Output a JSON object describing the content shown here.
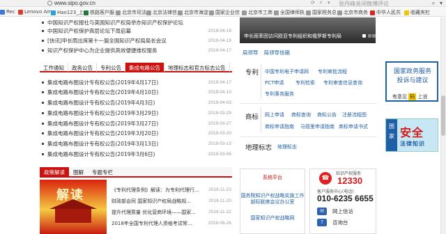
{
  "browser": {
    "url": "www.sipo.gov.cn",
    "search_hint": "张丹峰关闭微博评论",
    "bookmarks": [
      {
        "label": "Rec",
        "color": "#3b7bd8"
      },
      {
        "label": "Lenovo Am",
        "color": "#e03b2a"
      },
      {
        "label": "Hao123_上",
        "color": "#2aa0e0"
      },
      {
        "label": "铁路客户服",
        "color": "#1f7a3a"
      },
      {
        "label": "北京市司法",
        "color": "#999999"
      },
      {
        "label": "北京法律信",
        "color": "#999999"
      },
      {
        "label": "北京市海淀",
        "color": "#999999"
      },
      {
        "label": "国家企业信",
        "color": "#999999"
      },
      {
        "label": "北京市工商",
        "color": "#999999"
      },
      {
        "label": "全国律师执",
        "color": "#999999"
      },
      {
        "label": "国家税务总",
        "color": "#999999"
      },
      {
        "label": "北京市商务",
        "color": "#999999"
      },
      {
        "label": "中华人民共",
        "color": "#d22"
      },
      {
        "label": "收藏夹栏",
        "color": "#f3c500"
      }
    ]
  },
  "news_top": [
    {
      "title": "中国知识产权报社与英国知识产权局举办知识产权保护论坛",
      "date": ""
    },
    {
      "title": "中国知识产权保护高层论坛下周启幕",
      "date": "2019-04-19"
    },
    {
      "title": "[快讯]申长雨出席第十一届全国知识产权局局长会议",
      "date": "2019-04-19"
    },
    {
      "title": "知识产权保护中心为企业提供高效便捷维权服务",
      "date": "2019-04-17"
    }
  ],
  "tabs": {
    "items": [
      "工作通知",
      "政务公告",
      "专利公告",
      "集成电路公告",
      "地理标志和官方标志公告"
    ],
    "active_index": 3
  },
  "announcements": [
    {
      "title": "集成电路布图设计专有权公告(2019年4月17日)",
      "date": "2019-04-17"
    },
    {
      "title": "集成电路布图设计专有权公告(2019年4月10日)",
      "date": "2019-04-10"
    },
    {
      "title": "集成电路布图设计专有权公告(2019年4月3日)",
      "date": "2019-04-03"
    },
    {
      "title": "集成电路布图设计专有权公告(2019年3月29日)",
      "date": "2019-03-29"
    },
    {
      "title": "集成电路布图设计专有权公告(2019年3月27日)",
      "date": "2019-03-27"
    },
    {
      "title": "集成电路布图设计专有权公告(2019年3月20日)",
      "date": "2019-03-20"
    },
    {
      "title": "集成电路布图设计专有权公告(2019年3月13日)",
      "date": "2019-03-13"
    },
    {
      "title": "集成电路布图设计专有权公告(2019年3月6日)",
      "date": "2019-03-06"
    }
  ],
  "policy_tabs": {
    "items": [
      "政策解读",
      "图解",
      "专题专栏"
    ],
    "active_index": 0
  },
  "policy_image_caption": "解读",
  "policy_items": [
    {
      "title": "《专利代理条例》解读：为专利代理行...",
      "date": "2018-11-23"
    },
    {
      "title": "财政部会同 国家知识产权局战略规...",
      "date": "2018-11-20"
    },
    {
      "title": "提升代理质量 优化营商环境——国家...",
      "date": "2018-11-22"
    },
    {
      "title": "2018年全国专利代理人资格考试常...",
      "date": "2018-06-26"
    }
  ],
  "banner": {
    "caption": "申长雨率团访问欧亚专利组织和俄罗斯专利局",
    "leader_links": [
      "局领导",
      "局领导信箱"
    ]
  },
  "sections": {
    "patent": {
      "title": "专利",
      "links": [
        "中国专利电子申请网",
        "专利审批流程",
        "PCT申请",
        "专利检索",
        "专利审查信息查询",
        "专利事务服务"
      ]
    },
    "trademark": {
      "title": "商标",
      "links": [
        "网上申请",
        "商标查询",
        "商标公告",
        "注册流程图",
        "商标申请指南",
        "马德里申请指南",
        "商标申请书式"
      ]
    },
    "geo": {
      "title": "地理标志",
      "links": [
        "地理标志"
      ]
    }
  },
  "systems": [
    {
      "label": "系统平台",
      "red": true
    },
    {
      "label": "国务院知识产权战略实施工作部际联席会议办公室",
      "red": false
    },
    {
      "label": "国家知识产权战略网",
      "red": false
    }
  ],
  "hotline": {
    "label1": "知识产权服务",
    "num1": "12330",
    "label2": "客户服务中心(电话)",
    "num2": "010-6235 6655"
  },
  "services": [
    "网上信访",
    "咨询台"
  ],
  "promo": {
    "line1": "国家政务服务",
    "line2": "投诉与建议",
    "line3a": "有意见",
    "line3b": "码",
    "line3c": "上说"
  },
  "safe": {
    "side": [
      "国",
      "家"
    ],
    "big": "安全",
    "sub": "法律知识"
  }
}
